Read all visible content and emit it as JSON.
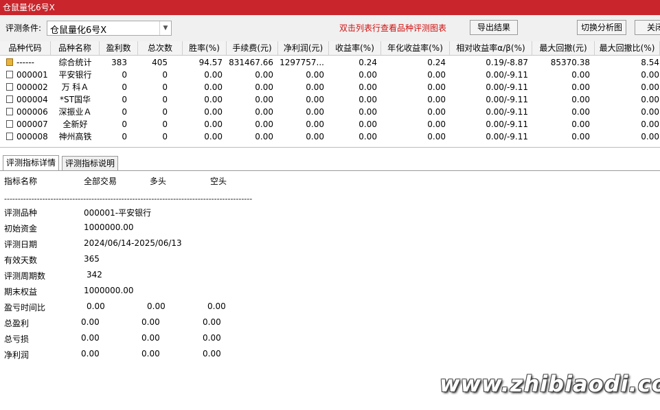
{
  "window": {
    "title": "仓鼠量化6号X"
  },
  "toolbar": {
    "condition_label": "评测条件:",
    "condition_value": "仓鼠量化6号X",
    "hint": "双击列表行查看品种评测图表",
    "export_label": "导出结果",
    "switch_label": "切换分析图",
    "close_label": "关闭"
  },
  "table": {
    "columns": [
      "品种代码",
      "品种名称",
      "盈利数",
      "总次数",
      "胜率(%)",
      "手续费(元)",
      "净利润(元)",
      "收益率(%)",
      "年化收益率(%)",
      "相对收益率α/β(%)",
      "最大回撤(元)",
      "最大回撤比(%)"
    ],
    "rows": [
      [
        "------",
        "综合统计",
        "383",
        "405",
        "94.57",
        "831467.66",
        "1297757...",
        "0.24",
        "0.24",
        "0.19/-8.87",
        "85370.38",
        "8.54"
      ],
      [
        "000001",
        "平安银行",
        "0",
        "0",
        "0.00",
        "0.00",
        "0.00",
        "0.00",
        "0.00",
        "0.00/-9.11",
        "0.00",
        "0.00"
      ],
      [
        "000002",
        "万 科Ａ",
        "0",
        "0",
        "0.00",
        "0.00",
        "0.00",
        "0.00",
        "0.00",
        "0.00/-9.11",
        "0.00",
        "0.00"
      ],
      [
        "000004",
        "*ST国华",
        "0",
        "0",
        "0.00",
        "0.00",
        "0.00",
        "0.00",
        "0.00",
        "0.00/-9.11",
        "0.00",
        "0.00"
      ],
      [
        "000006",
        "深振业Ａ",
        "0",
        "0",
        "0.00",
        "0.00",
        "0.00",
        "0.00",
        "0.00",
        "0.00/-9.11",
        "0.00",
        "0.00"
      ],
      [
        "000007",
        "全新好",
        "0",
        "0",
        "0.00",
        "0.00",
        "0.00",
        "0.00",
        "0.00",
        "0.00/-9.11",
        "0.00",
        "0.00"
      ],
      [
        "000008",
        "神州高铁",
        "0",
        "0",
        "0.00",
        "0.00",
        "0.00",
        "0.00",
        "0.00",
        "0.00/-9.11",
        "0.00",
        "0.00"
      ]
    ]
  },
  "tabs": [
    "评测指标详情",
    "评测指标说明"
  ],
  "detail": {
    "header": [
      "指标名称",
      "全部交易",
      "多头",
      "空头"
    ],
    "separator": "-------------------------------------------------------------------------------------------",
    "info": [
      {
        "label": "评测品种",
        "value": "000001-平安银行"
      },
      {
        "label": "初始资金",
        "value": "1000000.00"
      },
      {
        "label": "评测日期",
        "value": "2024/06/14-2025/06/13"
      },
      {
        "label": "有效天数",
        "value": "365"
      },
      {
        "label": "评测周期数",
        "value": "342"
      },
      {
        "label": "期末权益",
        "value": "1000000.00"
      }
    ],
    "stats": [
      {
        "label": "盈亏时间比",
        "all": "0.00",
        "long": "0.00",
        "short": "0.00"
      },
      {
        "label": "总盈利",
        "all": "0.00",
        "long": "0.00",
        "short": "0.00"
      },
      {
        "label": "总亏损",
        "all": "0.00",
        "long": "0.00",
        "short": "0.00"
      },
      {
        "label": "净利润",
        "all": "0.00",
        "long": "0.00",
        "short": "0.00"
      }
    ]
  },
  "watermark": "www.zhibiaodi.com"
}
